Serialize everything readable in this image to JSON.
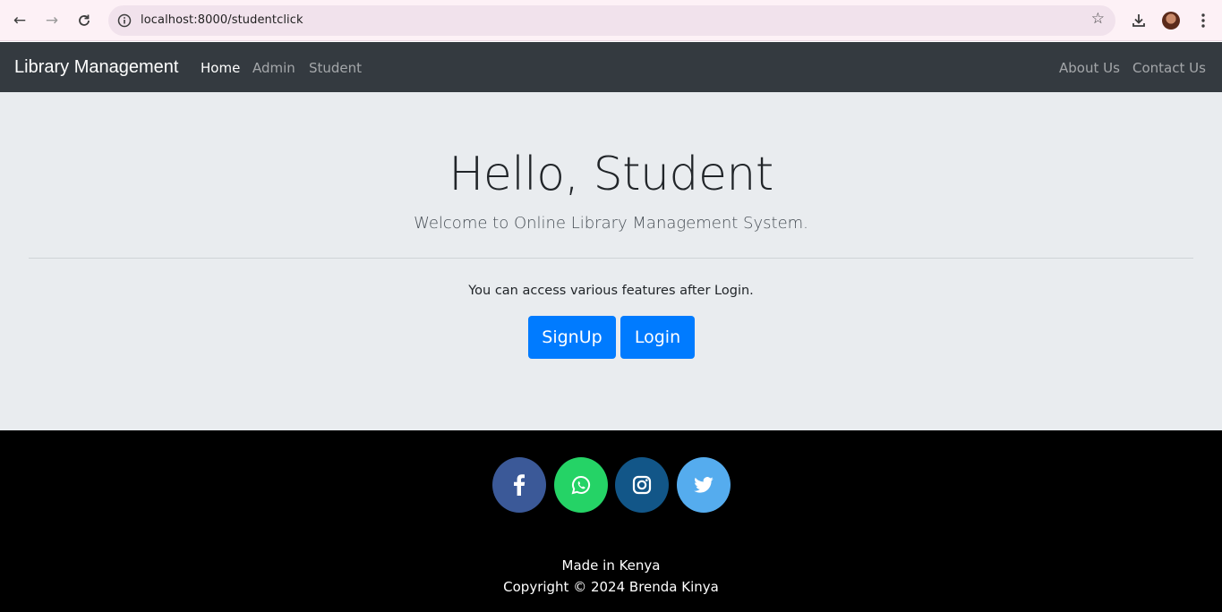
{
  "browser": {
    "url": "localhost:8000/studentclick",
    "icons": {
      "back": "back-arrow-icon",
      "forward": "forward-arrow-icon",
      "reload": "reload-icon",
      "site_info": "site-info-icon",
      "bookmark": "star-icon",
      "download": "download-icon",
      "profile": "avatar",
      "menu": "kebab-menu-icon"
    }
  },
  "navbar": {
    "brand": "Library Management",
    "left_links": [
      {
        "label": "Home",
        "active": true
      },
      {
        "label": "Admin",
        "active": false
      },
      {
        "label": "Student",
        "active": false
      }
    ],
    "right_links": [
      {
        "label": "About Us"
      },
      {
        "label": "Contact Us"
      }
    ]
  },
  "hero": {
    "title": "Hello, Student",
    "subtitle": "Welcome to Online Library Management System.",
    "text": "You can access various features after Login.",
    "signup_label": "SignUp",
    "login_label": "Login"
  },
  "footer": {
    "social": [
      {
        "name": "facebook-icon",
        "color": "#3b5998"
      },
      {
        "name": "whatsapp-icon",
        "color": "#25d366"
      },
      {
        "name": "instagram-icon",
        "color": "#125688"
      },
      {
        "name": "twitter-icon",
        "color": "#55acee"
      }
    ],
    "made_in": "Made in Kenya",
    "copyright": "Copyright © 2024 Brenda Kinya"
  },
  "colors": {
    "navbar_bg": "#343a40",
    "jumbotron_bg": "#e9ecef",
    "primary": "#007bff",
    "footer_bg": "#000000"
  }
}
